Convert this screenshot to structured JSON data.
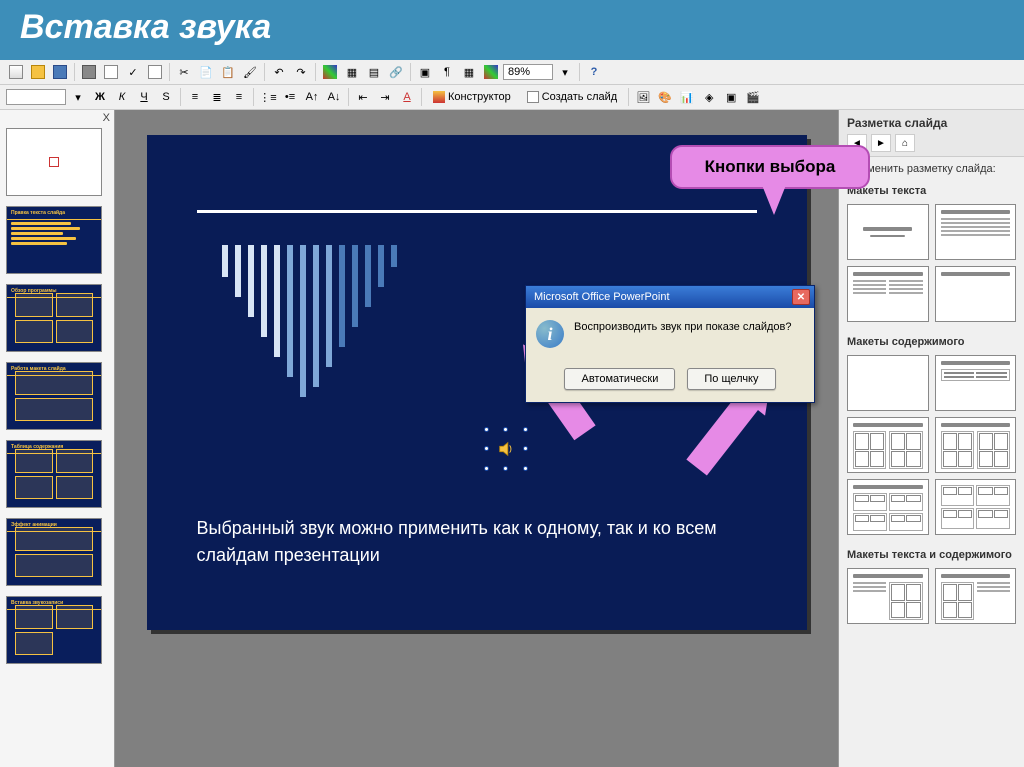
{
  "page": {
    "title": "Вставка звука"
  },
  "toolbar": {
    "zoom": "89%",
    "design_btn": "Конструктор",
    "new_slide_btn": "Создать слайд",
    "font_btns": [
      "Ж",
      "К",
      "Ч",
      "S"
    ]
  },
  "thumbs_panel": {
    "close": "X",
    "slides": [
      {
        "type": "white"
      },
      {
        "title": "Правка текста слайда",
        "lines": 5
      },
      {
        "title": "Обзор программы",
        "boxes": 4
      },
      {
        "title": "Работа макета слайда",
        "boxes": 2
      },
      {
        "title": "Таблица содержания",
        "boxes": 4
      },
      {
        "title": "Эффект анимации",
        "boxes": 2
      },
      {
        "title": "Вставка звукозаписи",
        "boxes": 3
      }
    ]
  },
  "slide": {
    "body_text": "Выбранный звук можно применить как к одному, так и ко всем слайдам презентации"
  },
  "callout": {
    "text": "Кнопки выбора"
  },
  "dialog": {
    "title": "Microsoft Office PowerPoint",
    "message": "Воспроизводить звук при показе слайдов?",
    "btn_auto": "Автоматически",
    "btn_click": "По щелчку",
    "close": "✕"
  },
  "task_pane": {
    "title": "Разметка слайда",
    "apply_label": "Применить разметку слайда:",
    "section_text": "Макеты текста",
    "section_content": "Макеты содержимого",
    "section_text_content": "Макеты текста и содержимого"
  }
}
